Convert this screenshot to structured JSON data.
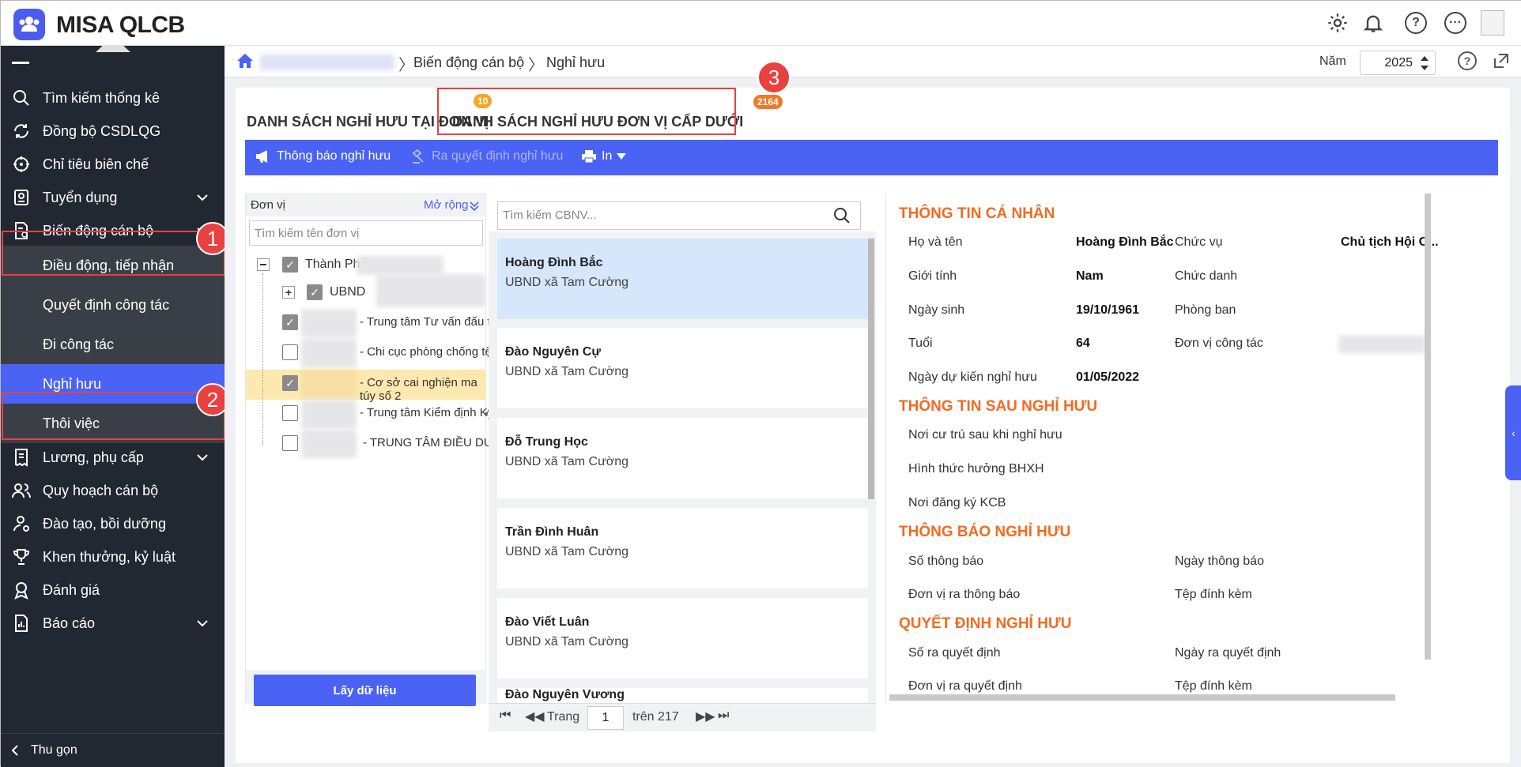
{
  "app": {
    "name": "MISA QLCB"
  },
  "topbar": {
    "icons": [
      "gear-icon",
      "bell-icon",
      "help-icon",
      "more-icon",
      "avatar"
    ]
  },
  "sidebar": {
    "items": [
      {
        "label": "Tìm kiếm thống kê",
        "icon": "search-icon"
      },
      {
        "label": "Đồng bộ CSDLQG",
        "icon": "sync-icon"
      },
      {
        "label": "Chỉ tiêu biên chế",
        "icon": "target-icon"
      },
      {
        "label": "Tuyển dụng",
        "icon": "badge-icon"
      },
      {
        "label": "Biến động cán bộ",
        "icon": "document-icon"
      },
      {
        "label": "Lương, phụ cấp",
        "icon": "receipt-icon"
      },
      {
        "label": "Quy hoạch cán bộ",
        "icon": "users-icon"
      },
      {
        "label": "Đào tạo, bồi dưỡng",
        "icon": "person-icon"
      },
      {
        "label": "Khen thưởng, kỷ luật",
        "icon": "trophy-icon"
      },
      {
        "label": "Đánh giá",
        "icon": "award-icon"
      },
      {
        "label": "Báo cáo",
        "icon": "report-icon"
      }
    ],
    "sub_items": [
      "Điều động, tiếp nhận",
      "Quyết định công tác",
      "Đi công tác",
      "Nghỉ hưu",
      "Thôi việc"
    ],
    "collapse_label": "Thu gọn",
    "markers": [
      "1",
      "2"
    ]
  },
  "breadcrumb": {
    "items": [
      "Biến động cán bộ",
      "Nghỉ hưu"
    ]
  },
  "year": {
    "label": "Năm",
    "value": "2025"
  },
  "tabs": [
    {
      "label": "DANH SÁCH NGHỈ HƯU TẠI ĐƠN VỊ",
      "count": "10"
    },
    {
      "label": "DANH SÁCH NGHỈ HƯU ĐƠN VỊ CẤP DƯỚI",
      "count": "2164"
    }
  ],
  "tab_marker": "3",
  "toolbar": {
    "notify": "Thông báo nghỉ hưu",
    "decide": "Ra quyết định nghỉ hưu",
    "print": "In"
  },
  "unit_panel": {
    "header": "Đơn vị",
    "expand": "Mở rộng",
    "search_placeholder": "Tìm kiếm tên đơn vị",
    "tree": [
      {
        "label": "Thành Phố",
        "checked": true
      },
      {
        "label": "UBND",
        "checked": true
      },
      {
        "label": "- Trung tâm Tư vấn đấu thầu ...",
        "checked": true
      },
      {
        "label": "- Chi cục phòng chống tệ nạn...",
        "checked": false
      },
      {
        "label": "- Cơ sở cai nghiện ma túy số 2",
        "checked": true
      },
      {
        "label": "- Trung tâm Kiểm định Kỹ thu...",
        "checked": false
      },
      {
        "label": "- TRUNG TÂM ĐIỀU DƯỠNG ...",
        "checked": false
      }
    ],
    "fetch_button": "Lấy dữ liệu"
  },
  "employee_list": {
    "search_placeholder": "Tìm kiếm CBNV...",
    "items": [
      {
        "name": "Hoàng Đình Bắc",
        "unit": "UBND xã Tam Cường"
      },
      {
        "name": "Đào Nguyên Cự",
        "unit": "UBND xã Tam Cường"
      },
      {
        "name": "Đỗ Trung Học",
        "unit": "UBND xã Tam Cường"
      },
      {
        "name": "Trần Đình Huân",
        "unit": "UBND xã Tam Cường"
      },
      {
        "name": "Đào Viết Luân",
        "unit": "UBND xã Tam Cường"
      },
      {
        "name": "Đào Nguyên Vương",
        "unit": ""
      }
    ],
    "pager": {
      "page_label": "Trang",
      "page": "1",
      "total": "trên 217"
    }
  },
  "details": {
    "personal": {
      "title": "THÔNG TIN CÁ NHÂN",
      "name_label": "Họ và tên",
      "name": "Hoàng Đình Bắc",
      "position_label": "Chức vụ",
      "position": "Chủ tịch Hội C...",
      "gender_label": "Giới tính",
      "gender": "Nam",
      "title_label": "Chức danh",
      "dob_label": "Ngày sinh",
      "dob": "19/10/1961",
      "dept_label": "Phòng ban",
      "age_label": "Tuổi",
      "age": "64",
      "workunit_label": "Đơn vị công tác",
      "retire_label": "Ngày dự kiến nghỉ hưu",
      "retire_date": "01/05/2022"
    },
    "after": {
      "title": "THÔNG TIN SAU NGHỈ HƯU",
      "residence": "Nơi cư trú sau khi nghỉ hưu",
      "insurance": "Hình thức hưởng BHXH",
      "kcb": "Nơi đăng ký KCB"
    },
    "notice": {
      "title": "THÔNG BÁO NGHỈ HƯU",
      "number": "Số thông báo",
      "date": "Ngày thông báo",
      "unit": "Đơn vị ra thông báo",
      "attach": "Tệp đính kèm"
    },
    "decision": {
      "title": "QUYẾT ĐỊNH NGHỈ HƯU",
      "number": "Số ra quyết định",
      "date": "Ngày ra quyết định",
      "unit": "Đơn vị ra quyết định",
      "attach": "Tệp đính kèm"
    }
  },
  "colors": {
    "accent": "#4a63f5",
    "sidebar": "#222831",
    "section": "#f26b21",
    "marker": "#e8413f"
  }
}
